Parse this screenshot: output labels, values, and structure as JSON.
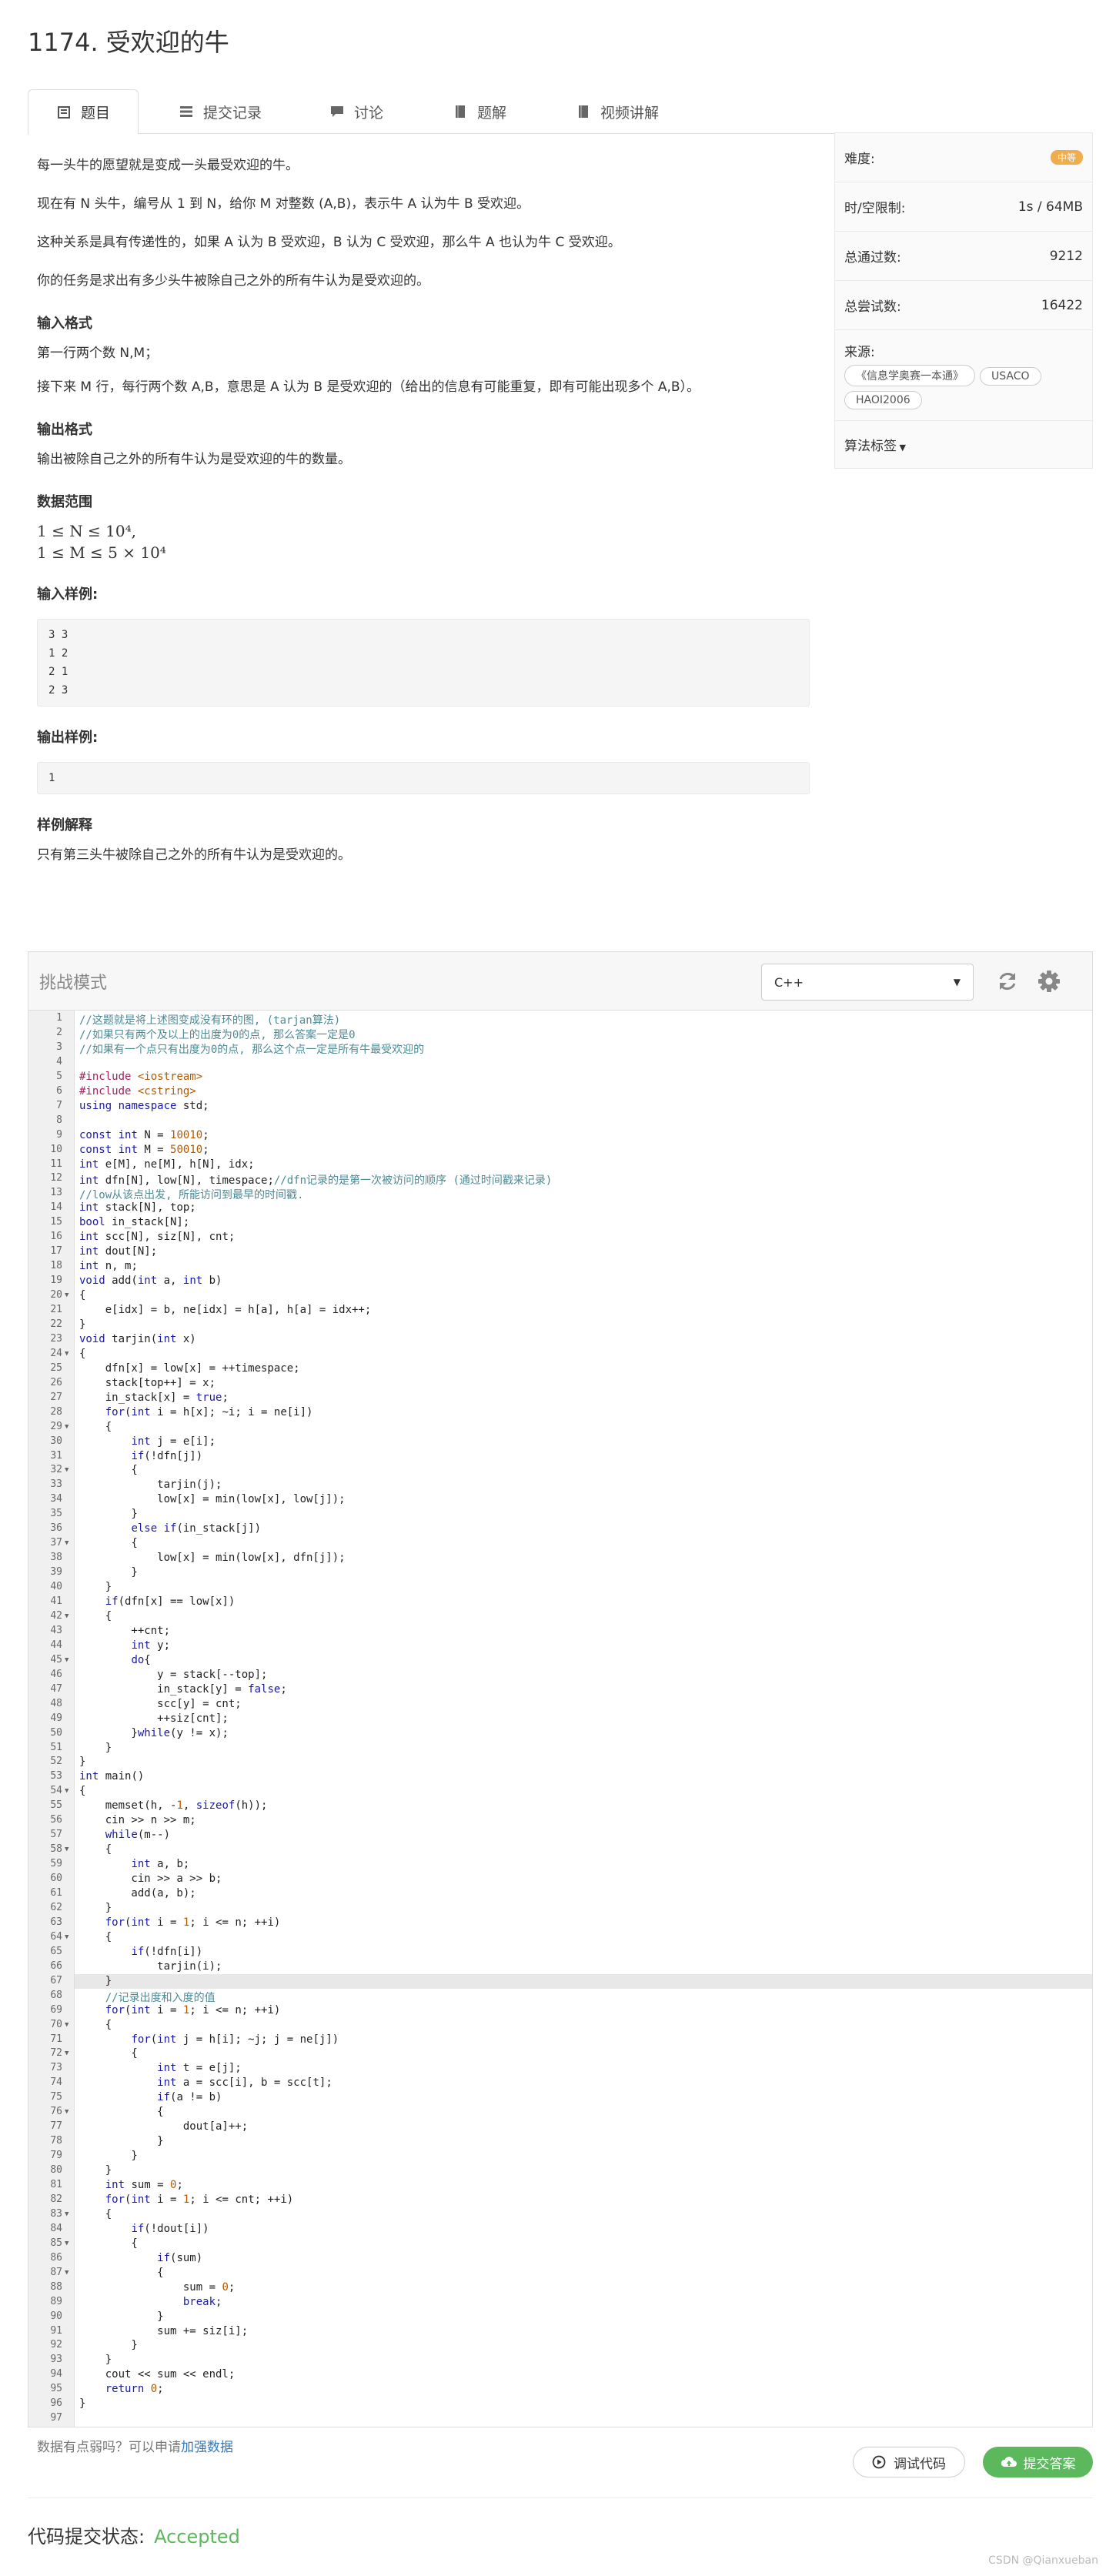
{
  "problem": {
    "title": "1174. 受欢迎的牛",
    "tabs": [
      {
        "label": "题目",
        "icon": "book-icon"
      },
      {
        "label": "提交记录",
        "icon": "list-icon"
      },
      {
        "label": "讨论",
        "icon": "comment-icon"
      },
      {
        "label": "题解",
        "icon": "solution-icon"
      },
      {
        "label": "视频讲解",
        "icon": "video-icon"
      }
    ],
    "desc1": "每一头牛的愿望就是变成一头最受欢迎的牛。",
    "desc2": "现在有 N 头牛，编号从 1 到 N，给你 M 对整数 (A,B)，表示牛 A 认为牛 B 受欢迎。",
    "desc3": "这种关系是具有传递性的，如果 A 认为 B 受欢迎，B 认为 C 受欢迎，那么牛 A 也认为牛 C 受欢迎。",
    "desc4": "你的任务是求出有多少头牛被除自己之外的所有牛认为是受欢迎的。",
    "input_heading": "输入格式",
    "input1": "第一行两个数 N,M；",
    "input2": "接下来 M 行，每行两个数 A,B，意思是 A 认为 B 是受欢迎的（给出的信息有可能重复，即有可能出现多个 A,B）。",
    "output_heading": "输出格式",
    "output1": "输出被除自己之外的所有牛认为是受欢迎的牛的数量。",
    "range_heading": "数据范围",
    "range1": "1 ≤ N ≤ 10⁴,",
    "range2": "1 ≤ M ≤ 5 × 10⁴",
    "sample_in_heading": "输入样例:",
    "sample_in": "3 3\n1 2\n2 1\n2 3",
    "sample_out_heading": "输出样例:",
    "sample_out": "1",
    "explain_heading": "样例解释",
    "explain": "只有第三头牛被除自己之外的所有牛认为是受欢迎的。"
  },
  "sidebar": {
    "difficulty_label": "难度:",
    "difficulty_value": "中等",
    "difficulty_color": "#f0ad4e",
    "limit_label": "时/空限制:",
    "limit_value": "1s / 64MB",
    "passed_label": "总通过数:",
    "passed_value": "9212",
    "tried_label": "总尝试数:",
    "tried_value": "16422",
    "source_label": "来源:",
    "sources": [
      "《信息学奥赛一本通》",
      "USACO",
      "HAOI2006"
    ],
    "algo_label": "算法标签"
  },
  "editor": {
    "mode": "挑战模式",
    "language": "C++",
    "code": [
      "//这题就是将上述图变成没有环的图, (tarjan算法)",
      "//如果只有两个及以上的出度为0的点, 那么答案一定是0",
      "//如果有一个点只有出度为0的点, 那么这个点一定是所有牛最受欢迎的",
      "",
      "#include <iostream>",
      "#include <cstring>",
      "using namespace std;",
      "",
      "const int N = 10010;",
      "const int M = 50010;",
      "int e[M], ne[M], h[N], idx;",
      "int dfn[N], low[N], timespace;//dfn记录的是第一次被访问的顺序 (通过时间戳来记录)",
      "//low从该点出发, 所能访问到最早的时间戳.",
      "int stack[N], top;",
      "bool in_stack[N];",
      "int scc[N], siz[N], cnt;",
      "int dout[N];",
      "int n, m;",
      "void add(int a, int b)",
      "{",
      "    e[idx] = b, ne[idx] = h[a], h[a] = idx++;",
      "}",
      "void tarjin(int x)",
      "{",
      "    dfn[x] = low[x] = ++timespace;",
      "    stack[top++] = x;",
      "    in_stack[x] = true;",
      "    for(int i = h[x]; ~i; i = ne[i])",
      "    {",
      "        int j = e[i];",
      "        if(!dfn[j])",
      "        {",
      "            tarjin(j);",
      "            low[x] = min(low[x], low[j]);",
      "        }",
      "        else if(in_stack[j])",
      "        {",
      "            low[x] = min(low[x], dfn[j]);",
      "        }",
      "    }",
      "    if(dfn[x] == low[x])",
      "    {",
      "        ++cnt;",
      "        int y;",
      "        do{",
      "            y = stack[--top];",
      "            in_stack[y] = false;",
      "            scc[y] = cnt;",
      "            ++siz[cnt];",
      "        }while(y != x);",
      "    }",
      "}",
      "int main()",
      "{",
      "    memset(h, -1, sizeof(h));",
      "    cin >> n >> m;",
      "    while(m--)",
      "    {",
      "        int a, b;",
      "        cin >> a >> b;",
      "        add(a, b);",
      "    }",
      "    for(int i = 1; i <= n; ++i)",
      "    {",
      "        if(!dfn[i])",
      "            tarjin(i);",
      "    }",
      "    //记录出度和入度的值",
      "    for(int i = 1; i <= n; ++i)",
      "    {",
      "        for(int j = h[i]; ~j; j = ne[j])",
      "        {",
      "            int t = e[j];",
      "            int a = scc[i], b = scc[t];",
      "            if(a != b)",
      "            {",
      "                dout[a]++;",
      "            }",
      "        }",
      "    }",
      "    int sum = 0;",
      "    for(int i = 1; i <= cnt; ++i)",
      "    {",
      "        if(!dout[i])",
      "        {",
      "            if(sum)",
      "            {",
      "                sum = 0;",
      "                break;",
      "            }",
      "            sum += siz[i];",
      "        }",
      "    }",
      "    cout << sum << endl;",
      "    return 0;",
      "}",
      ""
    ],
    "folds": [
      20,
      24,
      29,
      32,
      37,
      42,
      45,
      54,
      58,
      64,
      70,
      72,
      76,
      83,
      85,
      87
    ],
    "current_line": 67
  },
  "footer": {
    "hint_prefix": "数据有点弱吗？可以申请",
    "hint_link": "加强数据",
    "debug_label": "调试代码",
    "submit_label": "提交答案",
    "submit_color": "#5cb85c",
    "status_label": "代码提交状态:",
    "status_value": "Accepted",
    "watermark": "CSDN @Qianxueban"
  }
}
